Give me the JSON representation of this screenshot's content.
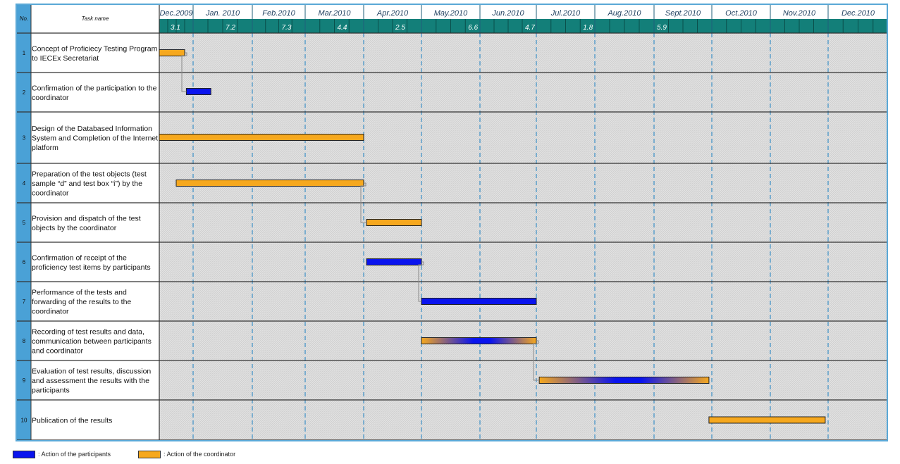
{
  "header": {
    "no_label": "No.",
    "task_label": "Task name"
  },
  "chart_data": {
    "type": "gantt",
    "months": [
      "Dec.2009",
      "Jan. 2010",
      "Feb.2010",
      "Mar.2010",
      "Apr.2010",
      "May.2010",
      "Jun.2010",
      "Jul.2010",
      "Aug.2010",
      "Sept.2010",
      "Oct.2010",
      "Nov.2010",
      "Dec.2010"
    ],
    "week_labels": [
      {
        "text": "3.1",
        "week": 1
      },
      {
        "text": "7.2",
        "week": 6
      },
      {
        "text": "7.3",
        "week": 10
      },
      {
        "text": "4.4",
        "week": 14
      },
      {
        "text": "2.5",
        "week": 18
      },
      {
        "text": "6.6",
        "week": 23
      },
      {
        "text": "4.7",
        "week": 27
      },
      {
        "text": "1.8",
        "week": 31
      },
      {
        "text": "5.9",
        "week": 36
      }
    ],
    "tasks": [
      {
        "no": "1",
        "name": [
          "Concept of Proficiecy Testing Program",
          "to IECEx Secretariat"
        ],
        "start": 0,
        "end": 0.75,
        "style": "coordinator"
      },
      {
        "no": "2",
        "name": [
          "Confirmation of the participation to the",
          "coordinator"
        ],
        "start": 0.8,
        "end": 1.3,
        "style": "participants"
      },
      {
        "no": "3",
        "name": [
          "Design of the Databased Information",
          "System and Completion of the Internet",
          "platform"
        ],
        "start": 0,
        "end": 4.0,
        "style": "coordinator"
      },
      {
        "no": "4",
        "name": [
          "Preparation of the test objects (test",
          "sample “d” and test box “i”) by the",
          "coordinator"
        ],
        "start": 0.5,
        "end": 4.0,
        "style": "coordinator"
      },
      {
        "no": "5",
        "name": [
          "Provision and dispatch of the test",
          "objects by the coordinator"
        ],
        "start": 4.05,
        "end": 5.0,
        "style": "coordinator"
      },
      {
        "no": "6",
        "name": [
          "Confirmation of  receipt of the",
          "proficiency test items by participants"
        ],
        "start": 4.05,
        "end": 5.0,
        "style": "participants"
      },
      {
        "no": "7",
        "name": [
          "Performance of the tests and",
          "forwarding of the results to the",
          "coordinator"
        ],
        "start": 5.0,
        "end": 7.0,
        "style": "participants"
      },
      {
        "no": "8",
        "name": [
          "Recording of test results and data,",
          "communication between participants",
          "and coordinator"
        ],
        "start": 5.0,
        "end": 7.0,
        "style": "both"
      },
      {
        "no": "9",
        "name": [
          "Evaluation of test results, discussion",
          "and assessment the results with the",
          "participants"
        ],
        "start": 7.05,
        "end": 9.95,
        "style": "both"
      },
      {
        "no": "10",
        "name": [
          "Publication of the results"
        ],
        "start": 9.95,
        "end": 11.95,
        "style": "coordinator"
      }
    ],
    "dependencies": [
      [
        0,
        1
      ],
      [
        3,
        4
      ],
      [
        5,
        6
      ],
      [
        7,
        8
      ]
    ],
    "legend": [
      {
        "label": ": Action of the participants",
        "color": "#0a14ee"
      },
      {
        "label": ": Action of the coordinator",
        "color": "#f6a81e"
      }
    ]
  },
  "colors": {
    "header_bg": "#137f79",
    "header_month_bg": "#ffffff",
    "row_bg": "#dedede",
    "no_col_bg": "#4aa1d6",
    "task_col_bg": "#ffffff",
    "coordinator": "#f6a81e",
    "participants": "#0a14ee",
    "dashed_line": "#3b8fc6"
  }
}
